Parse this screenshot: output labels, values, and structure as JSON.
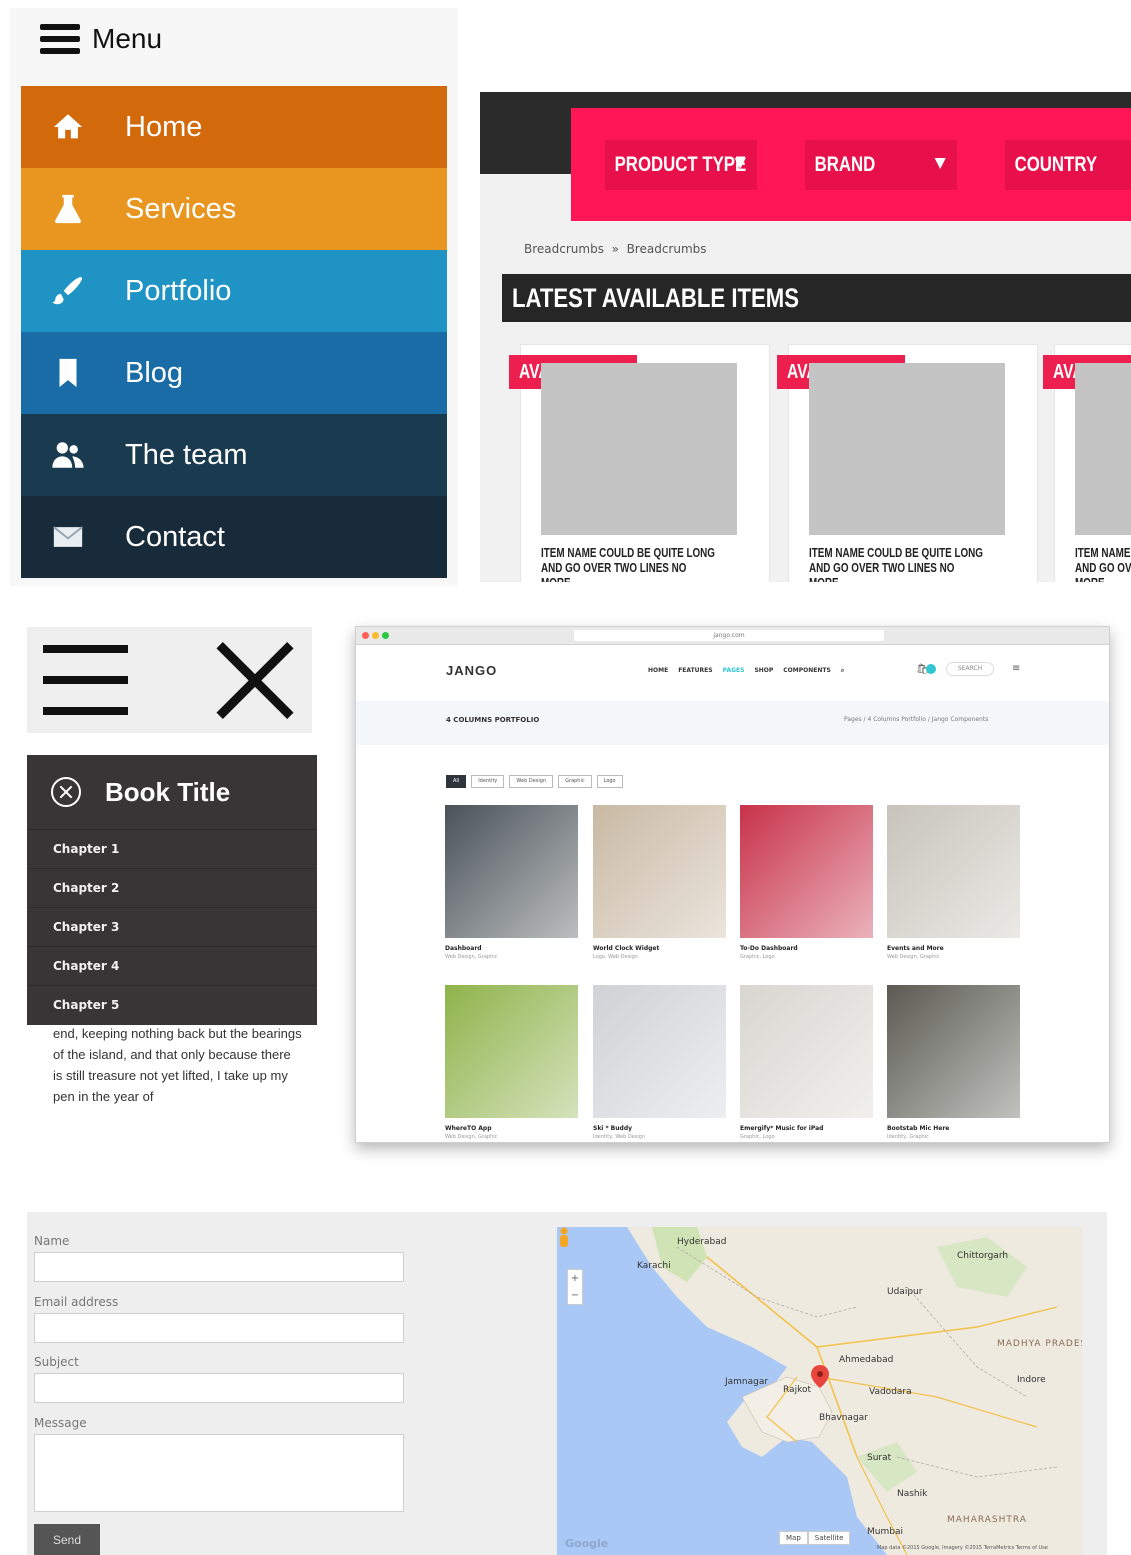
{
  "colors": {
    "menu_home": "#d2690b",
    "menu_services": "#e8961f",
    "menu_portfolio": "#1e93c4",
    "menu_blog": "#1a6ca6",
    "menu_team": "#1a3a4f",
    "menu_contact": "#172b3a",
    "shop_accent": "#ff1654",
    "book_bg": "#373535"
  },
  "menu": {
    "toggle_label": "Menu",
    "items": [
      {
        "label": "Home",
        "icon": "home-icon"
      },
      {
        "label": "Services",
        "icon": "flask-icon"
      },
      {
        "label": "Portfolio",
        "icon": "brush-icon"
      },
      {
        "label": "Blog",
        "icon": "bookmark-icon"
      },
      {
        "label": "The team",
        "icon": "team-icon"
      },
      {
        "label": "Contact",
        "icon": "envelope-icon"
      }
    ]
  },
  "shop": {
    "filters": [
      "PRODUCT TYPE",
      "BRAND",
      "COUNTRY"
    ],
    "breadcrumbs": [
      "Breadcrumbs",
      "Breadcrumbs"
    ],
    "breadcrumb_sep": "»",
    "heading": "LATEST AVAILABLE ITEMS",
    "products": [
      {
        "badge": "AVAILABLE",
        "name": "ITEM NAME COULD BE QUITE LONG AND GO OVER TWO LINES NO MORE..."
      },
      {
        "badge": "AVAILABLE",
        "name": "ITEM NAME COULD BE QUITE LONG AND GO OVER TWO LINES NO MORE..."
      },
      {
        "badge": "AVAILABLE",
        "name": "ITEM NAME COULD BE QUITE LONG AND GO OVER TWO LINES NO MORE..."
      }
    ]
  },
  "book": {
    "title": "Book Title",
    "chapters": [
      "Chapter 1",
      "Chapter 2",
      "Chapter 3",
      "Chapter 4",
      "Chapter 5"
    ],
    "text": "end, keeping nothing back but the bearings of the island, and that only because there is still treasure not yet lifted, I take up my pen in the year of"
  },
  "browser": {
    "url": "jango.com",
    "logo": "JANGO",
    "nav": [
      {
        "label": "HOME",
        "active": false
      },
      {
        "label": "FEATURES",
        "active": false
      },
      {
        "label": "PAGES",
        "active": true
      },
      {
        "label": "SHOP",
        "active": false
      },
      {
        "label": "COMPONENTS",
        "active": false
      }
    ],
    "search_label": "SEARCH",
    "page_title": "4 COLUMNS PORTFOLIO",
    "page_breadcrumb": "Pages / 4 Columns Portfolio / Jango Components",
    "filters": [
      {
        "label": "All",
        "active": true
      },
      {
        "label": "Identity",
        "active": false
      },
      {
        "label": "Web Design",
        "active": false
      },
      {
        "label": "Graphic",
        "active": false
      },
      {
        "label": "Logo",
        "active": false
      }
    ],
    "tiles": [
      {
        "title": "Dashboard",
        "sub": "Web Design, Graphic",
        "color": "#4a5258"
      },
      {
        "title": "World Clock Widget",
        "sub": "Logo, Web Design",
        "color": "#c9b9a4"
      },
      {
        "title": "To-Do Dashboard",
        "sub": "Graphic, Logo",
        "color": "#c8324a"
      },
      {
        "title": "Events and More",
        "sub": "Web Design, Graphic",
        "color": "#c8c4bb"
      },
      {
        "title": "WhereTO App",
        "sub": "Web Design, Graphic",
        "color": "#8fb34a"
      },
      {
        "title": "Ski * Buddy",
        "sub": "Identity, Web Design",
        "color": "#cfd2d6"
      },
      {
        "title": "Emergify* Music for iPad",
        "sub": "Graphic, Logo",
        "color": "#d8d6d0"
      },
      {
        "title": "Bootstab Mic Here",
        "sub": "Identity, Graphic",
        "color": "#5a5a52"
      }
    ]
  },
  "contact": {
    "name_label": "Name",
    "email_label": "Email address",
    "subject_label": "Subject",
    "message_label": "Message",
    "send_label": "Send",
    "name_value": "",
    "email_value": "",
    "subject_value": "",
    "message_value": ""
  },
  "map": {
    "labels": [
      {
        "text": "Hyderabad",
        "cls": ""
      },
      {
        "text": "Karachi",
        "cls": ""
      },
      {
        "text": "Ahmedabad",
        "cls": ""
      },
      {
        "text": "Rajkot",
        "cls": ""
      },
      {
        "text": "Vadodara",
        "cls": ""
      },
      {
        "text": "Udaipur",
        "cls": ""
      },
      {
        "text": "Indore",
        "cls": ""
      },
      {
        "text": "Bhavnagar",
        "cls": ""
      },
      {
        "text": "Surat",
        "cls": ""
      },
      {
        "text": "Nashik",
        "cls": ""
      },
      {
        "text": "Mumbai",
        "cls": ""
      },
      {
        "text": "MADHYA PRADESH",
        "cls": "big"
      },
      {
        "text": "MAHARASHTRA",
        "cls": "big"
      },
      {
        "text": "Chittorgarh",
        "cls": ""
      },
      {
        "text": "Jamnagar",
        "cls": ""
      }
    ],
    "map_btn": "Map",
    "satellite_btn": "Satellite",
    "google": "Google",
    "footer": "Map data ©2015 Google, Imagery ©2015 TerraMetrics Terms of Use"
  }
}
